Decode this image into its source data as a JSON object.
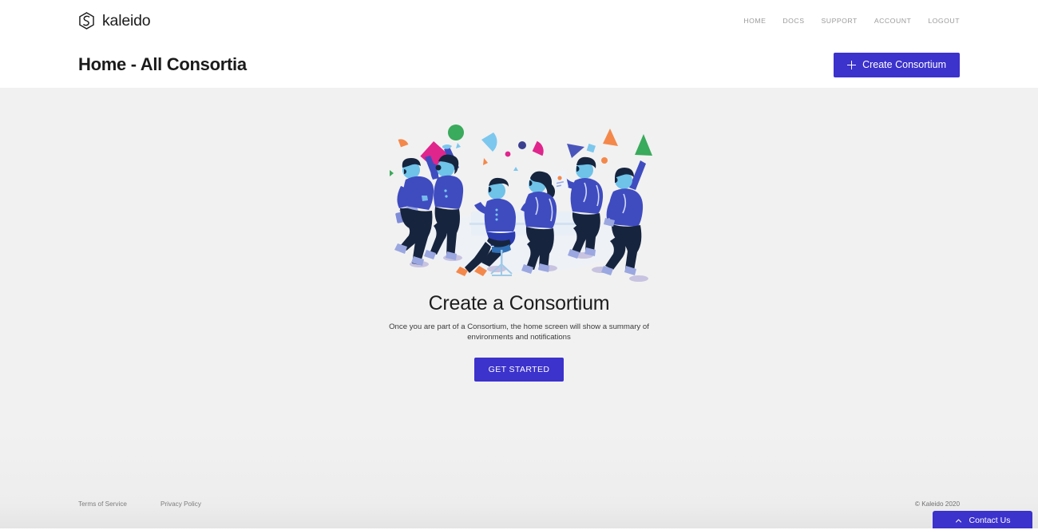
{
  "brand": {
    "name": "kaleido",
    "logo_icon": "kaleido-hex-logo"
  },
  "nav": {
    "items": [
      {
        "label": "HOME"
      },
      {
        "label": "DOCS"
      },
      {
        "label": "SUPPORT"
      },
      {
        "label": "ACCOUNT"
      },
      {
        "label": "LOGOUT"
      }
    ]
  },
  "header": {
    "title": "Home - All Consortia",
    "create_button": {
      "label": "Create Consortium",
      "icon": "plus-icon"
    }
  },
  "main": {
    "illustration_alt": "people-celebrating-illustration",
    "empty_state": {
      "title": "Create a Consortium",
      "description": "Once you are part of a Consortium, the home screen will show a summary of environments and notifications",
      "cta_label": "GET STARTED"
    }
  },
  "footer": {
    "links": [
      {
        "label": "Terms of Service"
      },
      {
        "label": "Privacy Policy"
      }
    ],
    "copyright": "© Kaleido 2020"
  },
  "contact": {
    "label": "Contact Us",
    "icon": "chevron-up-icon"
  },
  "colors": {
    "accent": "#3c32cc",
    "page_background": "#f1f1f1",
    "header_background": "#ffffff",
    "nav_text": "#9b9b9b",
    "title_text": "#1b1b1b"
  }
}
